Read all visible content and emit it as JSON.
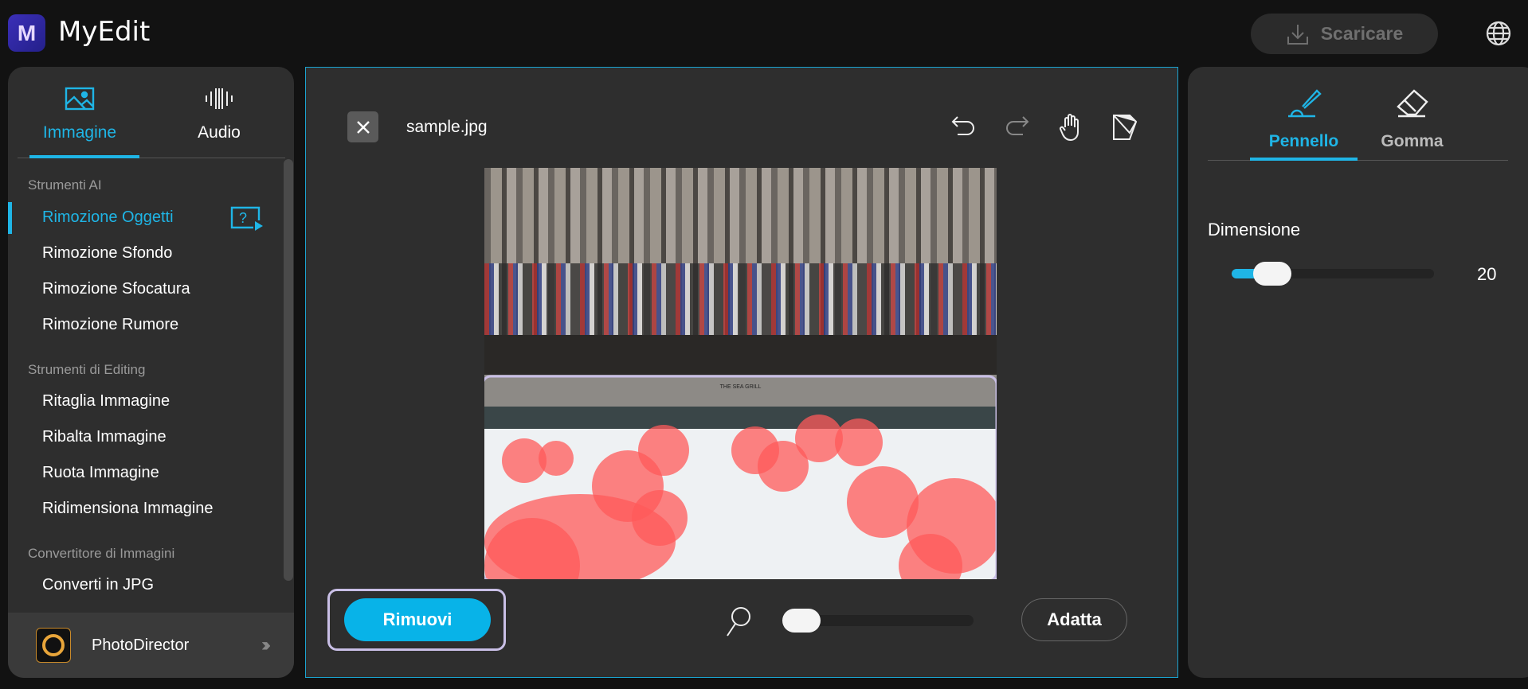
{
  "header": {
    "app_title": "MyEdit",
    "logo_letter": "M",
    "download_label": "Scaricare"
  },
  "left": {
    "tabs": [
      {
        "label": "Immagine",
        "active": true
      },
      {
        "label": "Audio",
        "active": false
      }
    ],
    "sections": [
      {
        "title": "Strumenti AI",
        "items": [
          "Rimozione Oggetti",
          "Rimozione Sfondo",
          "Rimozione Sfocatura",
          "Rimozione Rumore"
        ]
      },
      {
        "title": "Strumenti di Editing",
        "items": [
          "Ritaglia Immagine",
          "Ribalta Immagine",
          "Ruota Immagine",
          "Ridimensiona Immagine"
        ]
      },
      {
        "title": "Convertitore di Immagini",
        "items": [
          "Converti in JPG"
        ]
      }
    ],
    "active_item": "Rimozione Oggetti",
    "promo": {
      "label": "PhotoDirector"
    }
  },
  "canvas": {
    "filename": "sample.jpg",
    "remove_label": "Rimuovi",
    "fit_label": "Adatta",
    "zoom_percent": 0,
    "image_sign": "THE SEA GRILL"
  },
  "right": {
    "tabs": [
      {
        "label": "Pennello",
        "active": true
      },
      {
        "label": "Gomma",
        "active": false
      }
    ],
    "size_label": "Dimensione",
    "size_value": "20",
    "size_fraction": 0.2
  },
  "colors": {
    "accent": "#1fb5e6",
    "selection": "#c9bfe6",
    "mask": "#ff5a5a"
  }
}
